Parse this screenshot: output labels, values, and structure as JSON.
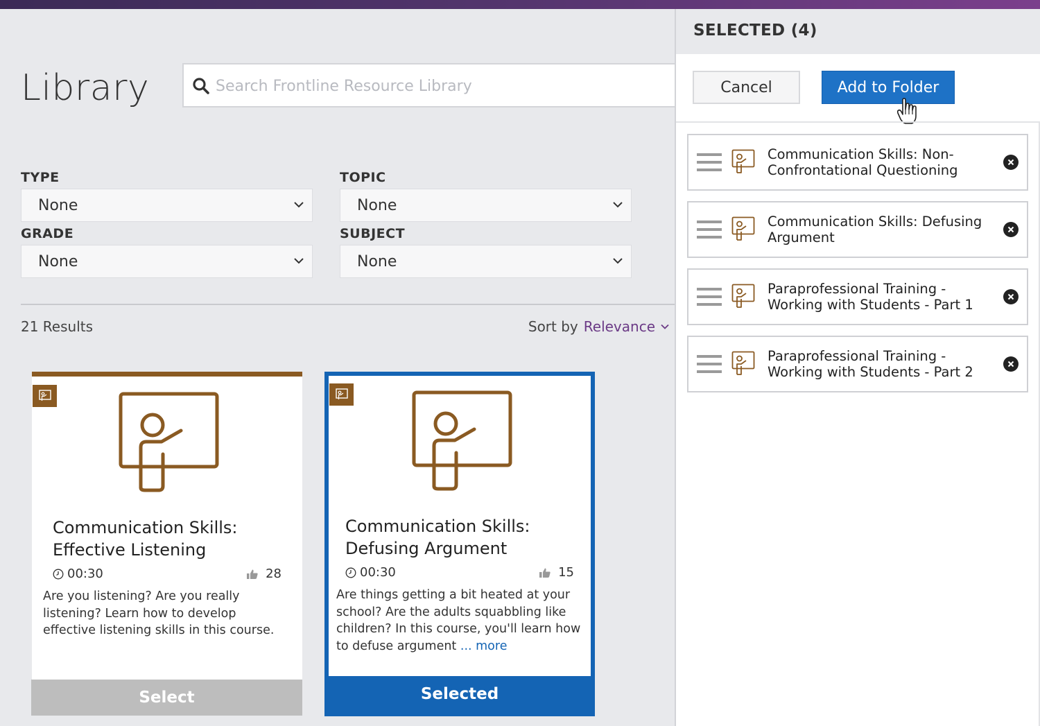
{
  "library": {
    "title": "Library",
    "search": {
      "placeholder": "Search Frontline Resource Library",
      "value": ""
    }
  },
  "filters": [
    {
      "label": "TYPE",
      "value": "None"
    },
    {
      "label": "TOPIC",
      "value": "None"
    },
    {
      "label": "GRADE",
      "value": "None"
    },
    {
      "label": "SUBJECT",
      "value": "None"
    }
  ],
  "results": {
    "count_label": "21 Results",
    "sort_label": "Sort by",
    "sort_value": "Relevance"
  },
  "cards": [
    {
      "title": "Communication Skills: Effective Listening",
      "duration": "00:30",
      "likes": "28",
      "description": "Are you listening? Are you really listening? Learn how to develop effective listening skills in this course.",
      "more": "",
      "button": "Select",
      "selected": false
    },
    {
      "title": "Communication Skills: Defusing Argument",
      "duration": "00:30",
      "likes": "15",
      "description": "Are things getting a bit heated at your school? Are the adults squabbling like children? In this course, you'll learn how to defuse argument",
      "more": "... more",
      "button": "Selected",
      "selected": true
    }
  ],
  "panel": {
    "title": "SELECTED (4)",
    "cancel_label": "Cancel",
    "add_label": "Add to Folder",
    "items": [
      {
        "label": "Communication Skills: Non-Confrontational Questioning"
      },
      {
        "label": "Communication Skills: Defusing Argument"
      },
      {
        "label": "Paraprofessional Training - Working with Students - Part 1"
      },
      {
        "label": "Paraprofessional Training - Working with Students - Part 2"
      }
    ]
  },
  "colors": {
    "accent_brown": "#8a5a22",
    "accent_blue": "#1464b4",
    "sort_purple": "#6b3a86"
  }
}
